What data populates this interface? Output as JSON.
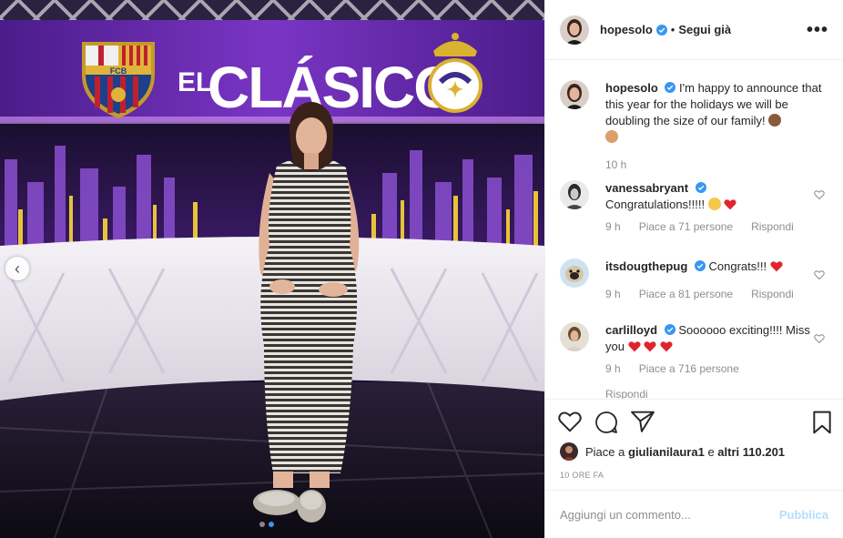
{
  "post": {
    "username": "hopesolo",
    "follow_status": "Segui già",
    "more_label": "•••"
  },
  "caption": {
    "username": "hopesolo",
    "text": "I'm happy to announce that this year for the holidays we will be doubling the size of our family!",
    "time": "10 h"
  },
  "photo": {
    "sign_el": "EL",
    "sign_clasico": "CLÁSICO",
    "fcb_letters": "FCB",
    "nav_glyph": "‹"
  },
  "comments": [
    {
      "username": "vanessabryant",
      "text": "Congratulations!!!!!",
      "time": "9 h",
      "likes": "Piace a 71 persone",
      "reply": "Rispondi"
    },
    {
      "username": "itsdougthepug",
      "text": "Congrats!!!",
      "time": "9 h",
      "likes": "Piace a 81 persone",
      "reply": "Rispondi"
    },
    {
      "username": "carlilloyd",
      "text": "Soooooo exciting!!!! Miss you",
      "time": "9 h",
      "likes": "Piace a 716 persone",
      "reply": "Rispondi"
    }
  ],
  "likes_summary": {
    "prefix": "Piace a",
    "user": "giulianilaura1",
    "middle": "e",
    "others": "altri 110.201"
  },
  "time_ago": "10 ORE FA",
  "comment_box": {
    "placeholder": "Aggiungi un commento...",
    "publish_label": "Pubblica"
  },
  "colors": {
    "verified": "#3897f0",
    "heart": "#ed4956",
    "publish_disabled": "#b2dffc",
    "stage_purple": "#6a2aa8"
  },
  "icons": [
    "chevron-left-icon",
    "more-icon",
    "verified-icon",
    "heart-icon",
    "comment-icon",
    "share-icon",
    "bookmark-icon",
    "red-heart-emoji-icon"
  ]
}
